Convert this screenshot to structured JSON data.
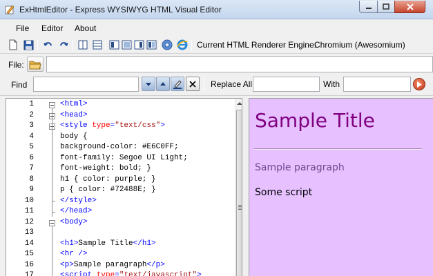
{
  "window": {
    "title": "ExHtmlEditor - Express WYSIWYG HTML Visual Editor",
    "controls": [
      "minimize",
      "maximize",
      "close"
    ]
  },
  "menu": {
    "items": [
      "File",
      "Editor",
      "About"
    ]
  },
  "toolbar": {
    "buttons": [
      "new-document-icon",
      "save-icon",
      "undo-icon",
      "redo-icon",
      "split-vertical-icon",
      "split-horizontal-icon",
      "layout-left-icon",
      "layout-single-icon",
      "layout-right-icon",
      "layout-grid-icon",
      "chromium-engine-icon",
      "ie-engine-icon"
    ],
    "engine_label": "Current HTML Renderer Engine:",
    "engine_value": "Chromium (Awesomium)"
  },
  "file_row": {
    "label": "File:",
    "path": ""
  },
  "find_row": {
    "find_label": "Find",
    "find_value": "",
    "replace_label": "Replace All",
    "replace_value": "",
    "with_label": "With",
    "with_value": ""
  },
  "editor": {
    "lines": [
      {
        "n": "1",
        "text": "<html>"
      },
      {
        "n": "2",
        "text": "<head>"
      },
      {
        "n": "3",
        "text": "<style type=\"text/css\">"
      },
      {
        "n": "4",
        "text": "body {"
      },
      {
        "n": "5",
        "text": "background-color: #E6C0FF;"
      },
      {
        "n": "6",
        "text": "font-family: Segoe UI Light;"
      },
      {
        "n": "7",
        "text": "font-weight: bold; }"
      },
      {
        "n": "8",
        "text": "h1 { color: purple; }"
      },
      {
        "n": "9",
        "text": "p { color: #72488E; }"
      },
      {
        "n": "10",
        "text": "</style>"
      },
      {
        "n": "11",
        "text": "</head>"
      },
      {
        "n": "12",
        "text": "<body>"
      },
      {
        "n": "13",
        "text": ""
      },
      {
        "n": "14",
        "text": "<h1>Sample Title</h1>"
      },
      {
        "n": "15",
        "text": "<hr />"
      },
      {
        "n": "16",
        "text": "<p>Sample paragraph</p>"
      },
      {
        "n": "17",
        "text": "<script type=\"text/javascript\">"
      }
    ]
  },
  "preview": {
    "background": "#E6C0FF",
    "h1_color": "purple",
    "p_color": "#72488E",
    "title": "Sample Title",
    "paragraph": "Sample paragraph",
    "script_output": "Some script"
  }
}
